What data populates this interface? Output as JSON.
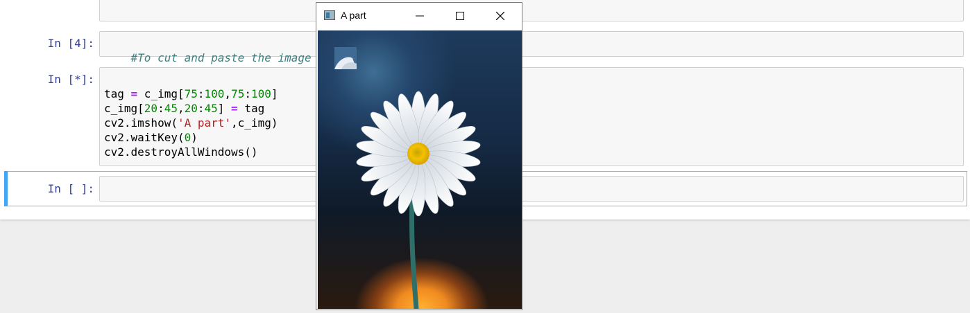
{
  "notebook": {
    "cells": [
      {
        "prompt": "",
        "lines": []
      },
      {
        "prompt": "In [4]:",
        "comment": "#To cut and paste the image"
      },
      {
        "prompt": "In [*]:",
        "code": {
          "l1_a": "tag ",
          "l1_op": "=",
          "l1_b": " c_img[",
          "l1_n1": "75",
          "l1_c1": ":",
          "l1_n2": "100",
          "l1_c2": ",",
          "l1_n3": "75",
          "l1_c3": ":",
          "l1_n4": "100",
          "l1_c4": "]",
          "l2_a": "c_img[",
          "l2_n1": "20",
          "l2_c1": ":",
          "l2_n2": "45",
          "l2_c2": ",",
          "l2_n3": "20",
          "l2_c3": ":",
          "l2_n4": "45",
          "l2_c4": "] ",
          "l2_op": "=",
          "l2_b": " tag",
          "l3_a": "cv2.imshow(",
          "l3_s": "'A part'",
          "l3_b": ",c_img)",
          "l4_a": "cv2.waitKey(",
          "l4_n": "0",
          "l4_b": ")",
          "l5": "cv2.destroyAllWindows()"
        }
      },
      {
        "prompt": "In [ ]:",
        "value": ""
      }
    ]
  },
  "cv_window": {
    "title": "A part",
    "minimize_glyph": "—",
    "maximize_glyph": "☐",
    "close_glyph": "✕",
    "image": "daisy-flower-image"
  },
  "colors": {
    "prompt": "#303f9f",
    "selected_bar": "#42a5f5",
    "comment": "#408080",
    "number": "#008800",
    "string": "#ba2121",
    "operator": "#aa22ff"
  }
}
